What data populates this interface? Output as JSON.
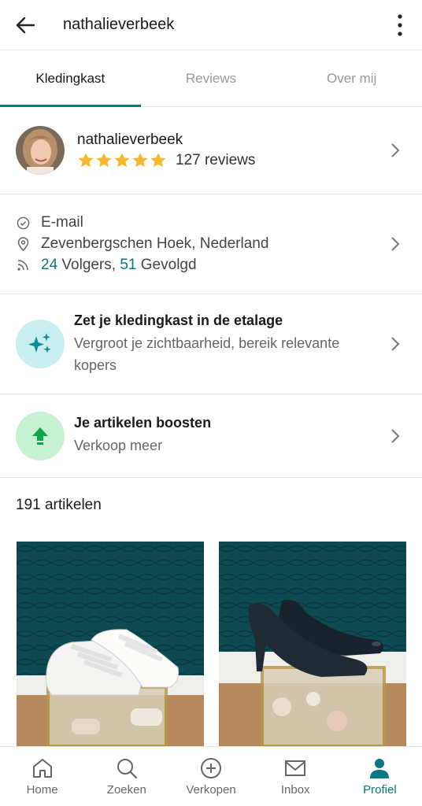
{
  "header": {
    "title": "nathalieverbeek",
    "back_icon": "arrow-left-icon",
    "more_icon": "more-vertical-icon"
  },
  "tabs": [
    {
      "label": "Kledingkast",
      "active": true
    },
    {
      "label": "Reviews",
      "active": false
    },
    {
      "label": "Over mij",
      "active": false
    }
  ],
  "profile": {
    "name": "nathalieverbeek",
    "stars": 5,
    "reviews_label": "127 reviews"
  },
  "info": {
    "email_label": "E-mail",
    "location": "Zevenbergschen Hoek, Nederland",
    "followers_count": "24",
    "followers_label": " Volgers, ",
    "following_count": "51",
    "following_label": " Gevolgd"
  },
  "showcase": {
    "title": "Zet je kledingkast in de etalage",
    "subtitle": "Vergroot je zichtbaarheid, bereik relevante kopers"
  },
  "boost": {
    "title": "Je artikelen boosten",
    "subtitle": "Verkoop meer"
  },
  "items": {
    "count_label": "191 artikelen"
  },
  "bottom_nav": [
    {
      "label": "Home",
      "icon": "home-icon",
      "active": false
    },
    {
      "label": "Zoeken",
      "icon": "search-icon",
      "active": false
    },
    {
      "label": "Verkopen",
      "icon": "plus-circle-icon",
      "active": false
    },
    {
      "label": "Inbox",
      "icon": "mail-icon",
      "active": false
    },
    {
      "label": "Profiel",
      "icon": "person-icon",
      "active": true
    }
  ],
  "colors": {
    "accent": "#09777f",
    "star": "#f5b82e",
    "showcase_bg": "#c9eef0",
    "boost_bg": "#c7f2d1"
  }
}
